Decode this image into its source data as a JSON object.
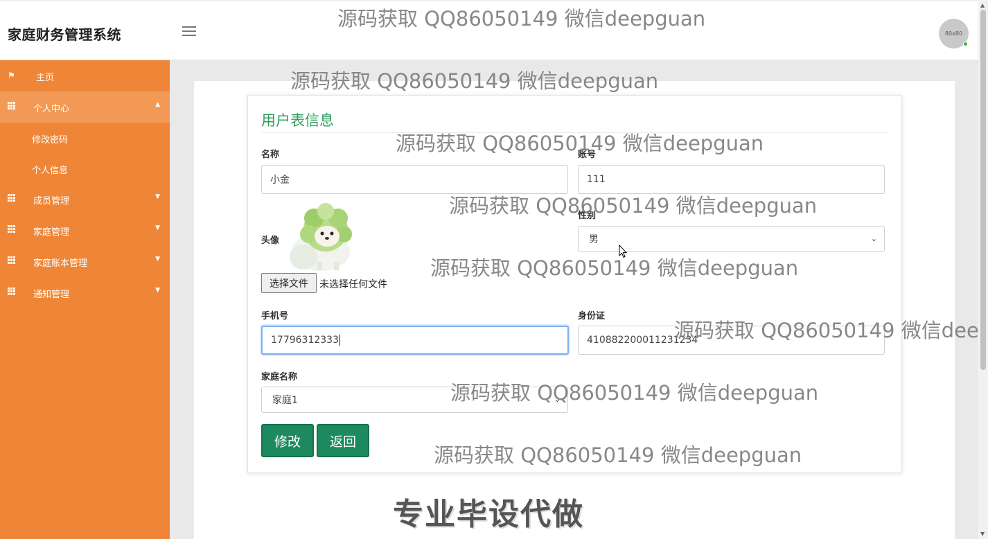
{
  "header": {
    "title": "家庭财务管理系统",
    "avatar_text": "80x80"
  },
  "sidebar": {
    "items": [
      {
        "label": "主页",
        "icon": "flag-icon"
      },
      {
        "label": "个人中心",
        "icon": "grid-icon",
        "expanded": true
      },
      {
        "label": "修改密码"
      },
      {
        "label": "个人信息"
      },
      {
        "label": "成员管理",
        "icon": "grid-icon"
      },
      {
        "label": "家庭管理",
        "icon": "grid-icon"
      },
      {
        "label": "家庭账本管理",
        "icon": "grid-icon"
      },
      {
        "label": "通知管理",
        "icon": "grid-icon"
      }
    ]
  },
  "form": {
    "title": "用户表信息",
    "name_label": "名称",
    "name_value": "小金",
    "account_label": "账号",
    "account_value": "111",
    "avatar_label": "头像",
    "file_button": "选择文件",
    "file_status": "未选择任何文件",
    "gender_label": "性别",
    "gender_value": "男",
    "phone_label": "手机号",
    "phone_value": "17796312333",
    "id_label": "身份证",
    "id_value": "410882200011231234",
    "family_label": "家庭名称",
    "family_value": "家庭1",
    "submit_label": "修改",
    "back_label": "返回"
  },
  "watermark": "源码获取 QQ86050149 微信deepguan",
  "banner": "专业毕设代做",
  "colors": {
    "sidebar": "#ef8637",
    "accent_green": "#1e8a60",
    "title_green": "#2e9e5c"
  }
}
